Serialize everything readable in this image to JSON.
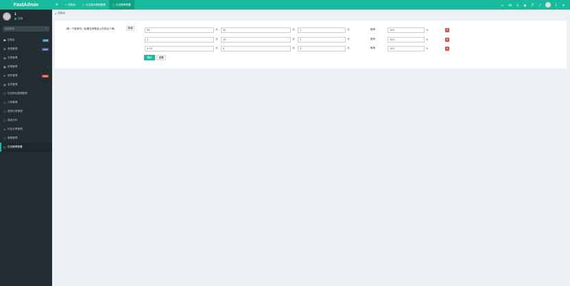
{
  "app": {
    "logo": "FastAdmin"
  },
  "user": {
    "name": "1",
    "status": "在线"
  },
  "sidebar": {
    "search_placeholder": "搜索菜单",
    "search_icon": "search-icon",
    "items": [
      {
        "icon": "dashboard-icon",
        "label": "控制台",
        "badge": "hot",
        "badge_color": "blue"
      },
      {
        "icon": "gear-icon",
        "label": "常规管理",
        "badge": "new",
        "badge_color": "purple"
      },
      {
        "icon": "list-icon",
        "label": "分类管理"
      },
      {
        "icon": "users-icon",
        "label": "权限管理",
        "chevron": "‹"
      },
      {
        "icon": "rocket-icon",
        "label": "插件管理",
        "badge": "new",
        "badge_color": "red"
      },
      {
        "icon": "list-icon",
        "label": "会员管理",
        "chevron": "‹"
      },
      {
        "icon": "circle-icon",
        "label": "红包购买数据管理"
      },
      {
        "icon": "circle-icon",
        "label": "订单管理"
      },
      {
        "icon": "circle-icon",
        "label": "提现记录管理"
      },
      {
        "icon": "circle-icon",
        "label": "佣金分析"
      },
      {
        "icon": "arrow-icon",
        "label": "红包分享管理"
      },
      {
        "icon": "circle-icon",
        "label": "客服管理"
      },
      {
        "icon": "circle-icon",
        "label": "红包概率配置",
        "active": true
      }
    ]
  },
  "topbar": {
    "tabs": [
      {
        "icon": "home-icon",
        "label": "控制台"
      },
      {
        "icon": "circle-icon",
        "label": "红包购买数据管理"
      },
      {
        "icon": "circle-icon",
        "label": "红包概率配置",
        "active": true
      }
    ],
    "icons": [
      "home-icon",
      "trash-icon",
      "refresh-icon",
      "bell-icon",
      "translate-icon",
      "expand-icon",
      "avatar",
      "user-label",
      "gear-icon"
    ],
    "user_label": "1"
  },
  "breadcrumb": {
    "label": "控制台"
  },
  "form": {
    "label": "(第一个框填写) (如果没有是金以外的这个单)",
    "add_label": "新增",
    "rows": [
      {
        "v1": "30",
        "u1": "元",
        "v2": "50",
        "u2": "元",
        "v3": "1",
        "u3": "元",
        "prob_label": "概率",
        "prob": "100",
        "pct": "%"
      },
      {
        "v1": "1",
        "u1": "元",
        "v2": "10",
        "u2": "元",
        "v3": "2",
        "u3": "元",
        "prob_label": "概率",
        "prob": "100",
        "pct": "%"
      },
      {
        "v1": "0.25",
        "u1": "元",
        "v2": "0",
        "u2": "元",
        "v3": "3",
        "u3": "元",
        "prob_label": "概率",
        "prob": "100",
        "pct": "%"
      }
    ],
    "submit_label": "确定",
    "reset_label": "重置"
  },
  "colors": {
    "accent": "#18bc9c",
    "sidebar": "#222d32",
    "danger": "#e74c3c"
  }
}
